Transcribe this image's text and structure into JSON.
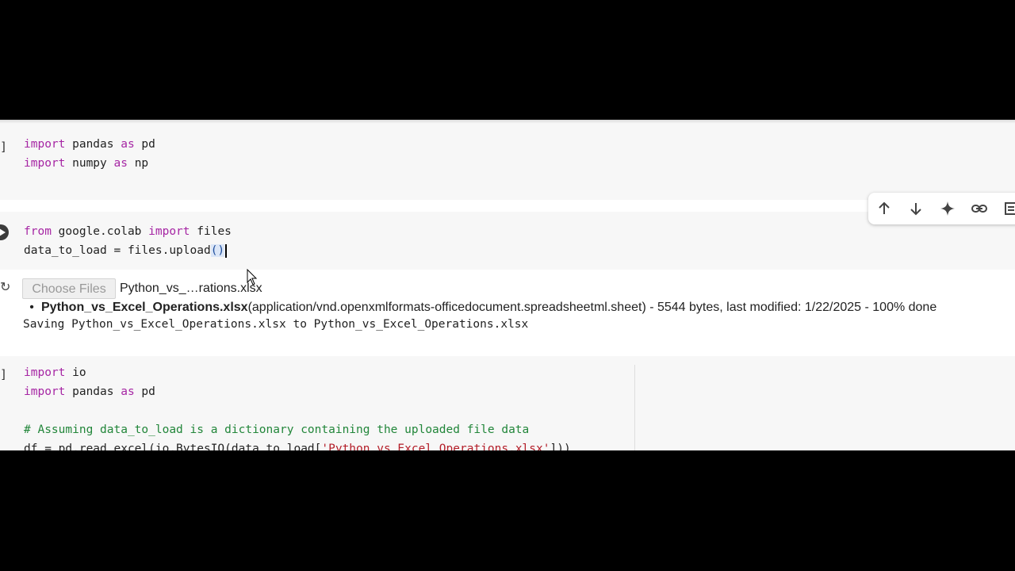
{
  "cells": [
    {
      "gutter": "]",
      "lines": [
        {
          "kw1": "import",
          "t1": " pandas ",
          "kw2": "as",
          "t2": " pd"
        },
        {
          "kw1": "import",
          "t1": " numpy ",
          "kw2": "as",
          "t2": " np"
        }
      ]
    },
    {
      "line1": {
        "kw1": "from",
        "t1": " google.colab ",
        "kw2": "import",
        "t2": " files"
      },
      "line2": {
        "t1": "data_to_load = files.upload",
        "paren": "()"
      }
    },
    {
      "gutter": "]",
      "line1": {
        "kw1": "import",
        "t1": " io"
      },
      "line2": {
        "kw1": "import",
        "t1": " pandas ",
        "kw2": "as",
        "t2": " pd"
      },
      "comment": "# Assuming data_to_load is a dictionary containing the uploaded file data",
      "line4": {
        "t1": "df = pd.read_excel(io.BytesIO(data_to_load[",
        "str": "'Python_vs_Excel_Operations.xlsx'",
        "t2": "]))"
      }
    }
  ],
  "output": {
    "choose_label": "Choose Files",
    "chosen_name": "Python_vs_…rations.xlsx",
    "file_name": "Python_vs_Excel_Operations.xlsx",
    "file_details": "(application/vnd.openxmlformats-officedocument.spreadsheetml.sheet) - 5544 bytes, last modified: 1/22/2025 - 100% done",
    "saving": "Saving Python_vs_Excel_Operations.xlsx to Python_vs_Excel_Operations.xlsx"
  },
  "toolbar": {
    "icons": [
      "arrow-up-icon",
      "arrow-down-icon",
      "sparkle-icon",
      "link-icon",
      "comment-icon"
    ]
  }
}
